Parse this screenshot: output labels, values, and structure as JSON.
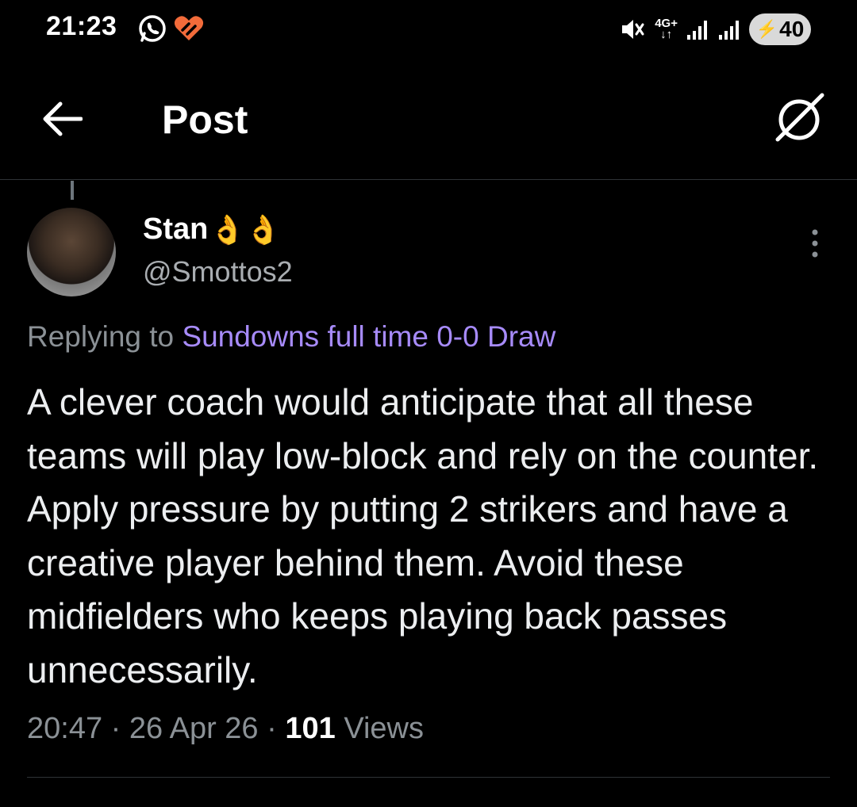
{
  "status_bar": {
    "time": "21:23",
    "network": "4G+",
    "battery": "40",
    "icons": [
      "whatsapp-icon",
      "heart-notification-icon",
      "mute-icon",
      "signal-icon",
      "signal-icon",
      "battery-charging-icon"
    ]
  },
  "header": {
    "title": "Post",
    "icons": [
      "back-arrow-icon",
      "grok-icon"
    ]
  },
  "post": {
    "author_name": "Stan",
    "author_emoji": "👌👌",
    "author_handle": "@Smottos2",
    "replying_prefix": "Replying to ",
    "replying_to": "Sundowns full time 0-0 Draw",
    "text": "A clever coach would anticipate that all these teams will play low-block and rely on the counter. Apply pressure by putting 2 strikers and have a creative player behind them. Avoid these midfielders who keeps playing back passes unnecessarily.",
    "time": "20:47",
    "date": "26 Apr 26",
    "views_count": "101",
    "views_label": "Views"
  },
  "colors": {
    "background": "#000000",
    "link": "#a78bfa",
    "secondary_text": "#8b9196",
    "divider": "#2f3336"
  }
}
